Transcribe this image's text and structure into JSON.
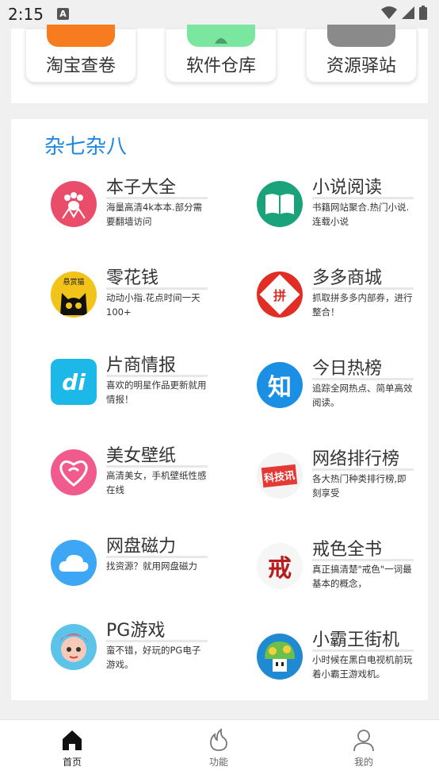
{
  "status_bar": {
    "time": "2:15",
    "notification_icon": "A"
  },
  "top_tools": [
    {
      "label": "淘宝查卷",
      "icon": "taobao-icon",
      "color": "#f77b1f"
    },
    {
      "label": "软件仓库",
      "icon": "android-icon",
      "color": "#7be6a0"
    },
    {
      "label": "资源驿站",
      "icon": "box-icon",
      "color": "#8a8a8a"
    }
  ],
  "misc": {
    "title": "杂七杂八",
    "apps": [
      {
        "name": "本子大全",
        "desc": "海量高清4k本本.部分需要翻墙访问",
        "color": "#ea4d6a"
      },
      {
        "name": "小说阅读",
        "desc": "书籍网站聚合.热门小说.连载小说",
        "color": "#1aa37a"
      },
      {
        "name": "零花钱",
        "desc": "动动小指.花点时间一天100+",
        "color": "#f2c318",
        "badge": "悬赏猫"
      },
      {
        "name": "多多商城",
        "desc": "抓取拼多多内部券，进行整合！",
        "color": "#e02e24",
        "badge": "拼"
      },
      {
        "name": "片商情报",
        "desc": "喜欢的明星作品更新就用情报！",
        "color": "#1bb8e8",
        "badge": "di"
      },
      {
        "name": "今日热榜",
        "desc": "追踪全网热点、简单高效阅读。",
        "color": "#1a8fe3",
        "badge": "知"
      },
      {
        "name": "美女壁纸",
        "desc": "高清美女，手机壁纸性感在线",
        "color": "#f05a8c"
      },
      {
        "name": "网络排行榜",
        "desc": "各大热门种类排行榜,即刻享受",
        "color": "#e53935",
        "badge": "科技讯"
      },
      {
        "name": "网盘磁力",
        "desc": "找资源？就用网盘磁力",
        "color": "#3da7f5"
      },
      {
        "name": "戒色全书",
        "desc": "真正搞清楚\"戒色\"一词最基本的概念，",
        "color": "#f6f6f6",
        "badge": "戒"
      },
      {
        "name": "PG游戏",
        "desc": "蛮不错，好玩的PG电子游戏。",
        "color": "#5bc4e8"
      },
      {
        "name": "小霸王街机",
        "desc": "小时候在黑白电视机前玩着小霸王游戏机。",
        "color": "#1f8ad1"
      }
    ]
  },
  "bottom_nav": [
    {
      "label": "首页",
      "icon": "home-icon",
      "active": true
    },
    {
      "label": "功能",
      "icon": "fire-icon",
      "active": false
    },
    {
      "label": "我的",
      "icon": "person-icon",
      "active": false
    }
  ]
}
